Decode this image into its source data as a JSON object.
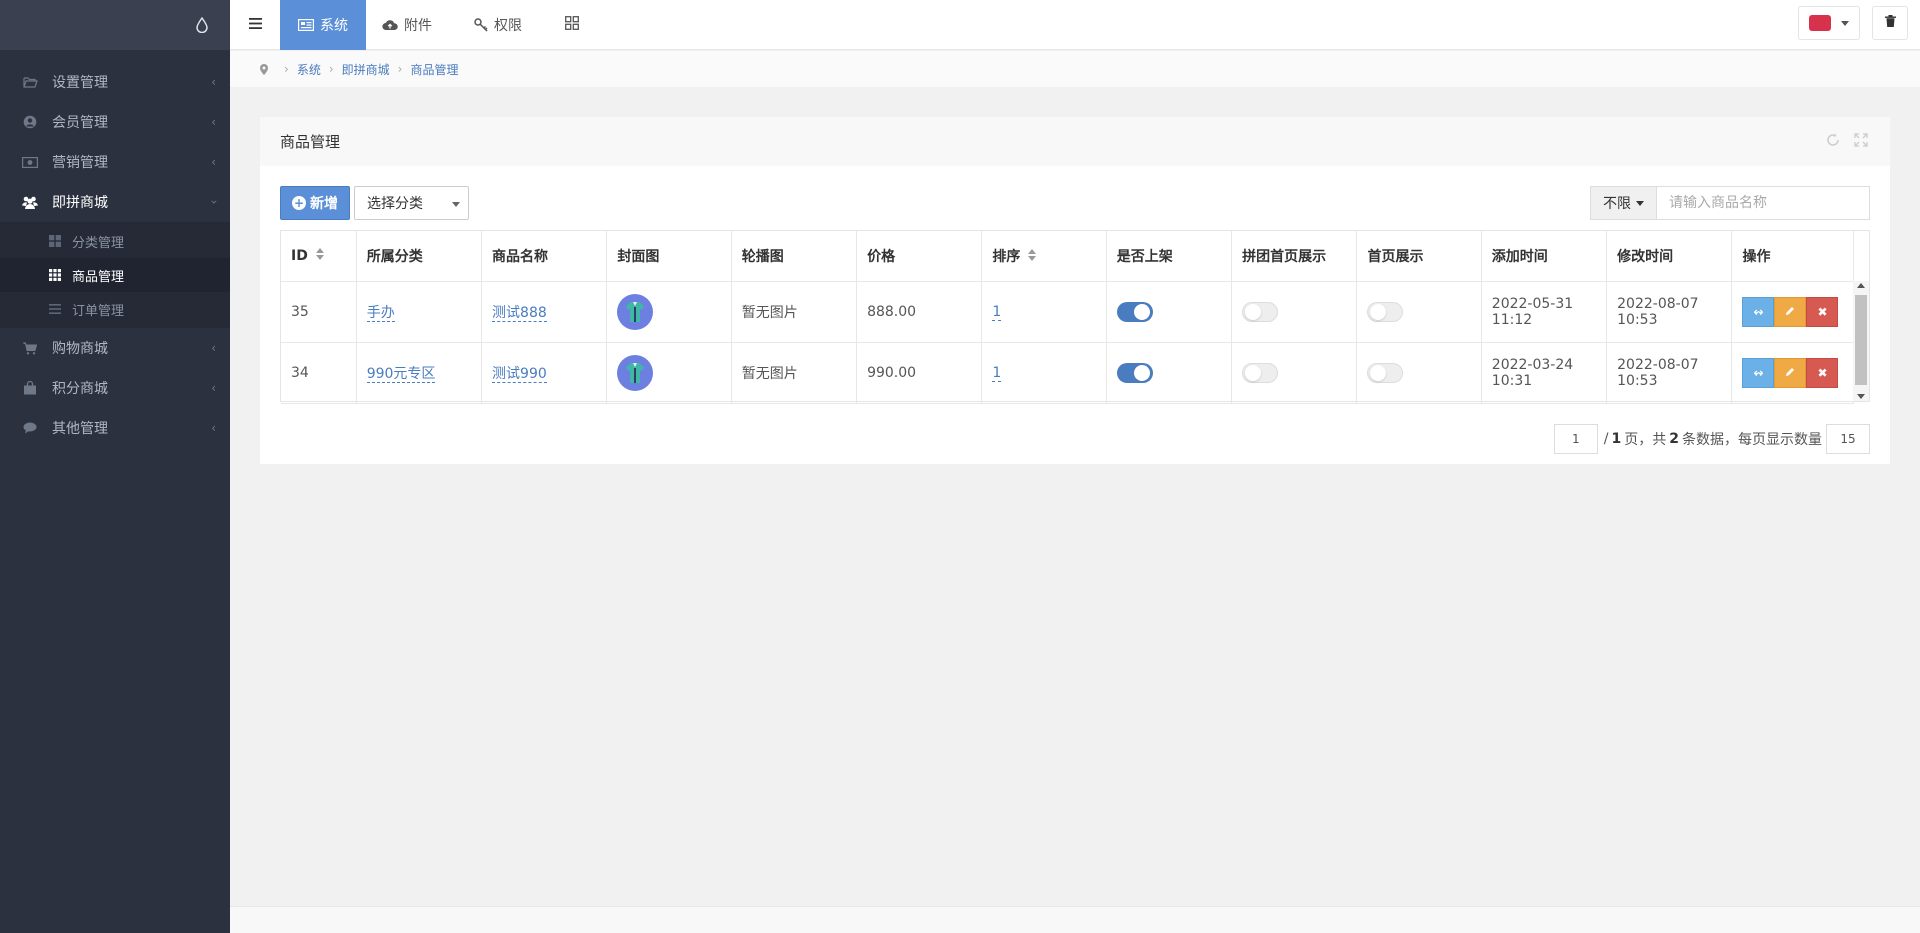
{
  "sidebar": {
    "items": [
      {
        "label": "设置管理",
        "icon": "folder-open-icon"
      },
      {
        "label": "会员管理",
        "icon": "user-circle-icon"
      },
      {
        "label": "营销管理",
        "icon": "money-icon"
      },
      {
        "label": "即拼商城",
        "icon": "users-icon",
        "open": true
      },
      {
        "label": "购物商城",
        "icon": "cart-icon"
      },
      {
        "label": "积分商城",
        "icon": "shopping-bag-icon"
      },
      {
        "label": "其他管理",
        "icon": "comment-icon"
      }
    ],
    "subitems": [
      {
        "label": "分类管理",
        "icon": "th-large-icon"
      },
      {
        "label": "商品管理",
        "icon": "th-icon",
        "active": true
      },
      {
        "label": "订单管理",
        "icon": "list-icon"
      }
    ]
  },
  "topbar": {
    "tabs": [
      {
        "label": "系统",
        "icon": "system-icon",
        "active": true
      },
      {
        "label": "附件",
        "icon": "cloud-upload-icon"
      },
      {
        "label": "权限",
        "icon": "key-icon"
      }
    ]
  },
  "breadcrumb": [
    "系统",
    "即拼商城",
    "商品管理"
  ],
  "panel": {
    "title": "商品管理",
    "add_label": "新增",
    "category_select": "选择分类",
    "filter_label": "不限",
    "search_placeholder": "请输入商品名称"
  },
  "table": {
    "columns": [
      "ID",
      "所属分类",
      "商品名称",
      "封面图",
      "轮播图",
      "价格",
      "排序",
      "是否上架",
      "拼团首页展示",
      "首页展示",
      "添加时间",
      "修改时间",
      "操作"
    ],
    "rows": [
      {
        "id": "35",
        "category": "手办",
        "name": "测试888",
        "carousel": "暂无图片",
        "price": "888.00",
        "sort": "1",
        "on_shelf": true,
        "group_home": false,
        "home": false,
        "added": "2022-05-31 11:12",
        "modified": "2022-08-07 10:53"
      },
      {
        "id": "34",
        "category": "990元专区",
        "name": "测试990",
        "carousel": "暂无图片",
        "price": "990.00",
        "sort": "1",
        "on_shelf": true,
        "group_home": false,
        "home": false,
        "added": "2022-03-24 10:31",
        "modified": "2022-08-07 10:53"
      }
    ]
  },
  "pager": {
    "current_page": "1",
    "total_pages": "1",
    "total_records": "2",
    "page_size": "15",
    "text_pages_prefix": "/",
    "text_pages_suffix": "页，共",
    "text_records_suffix": "条数据，每页显示数量"
  },
  "colors": {
    "accent": "#5b8fd8",
    "sidebar_bg": "#2c3140"
  }
}
